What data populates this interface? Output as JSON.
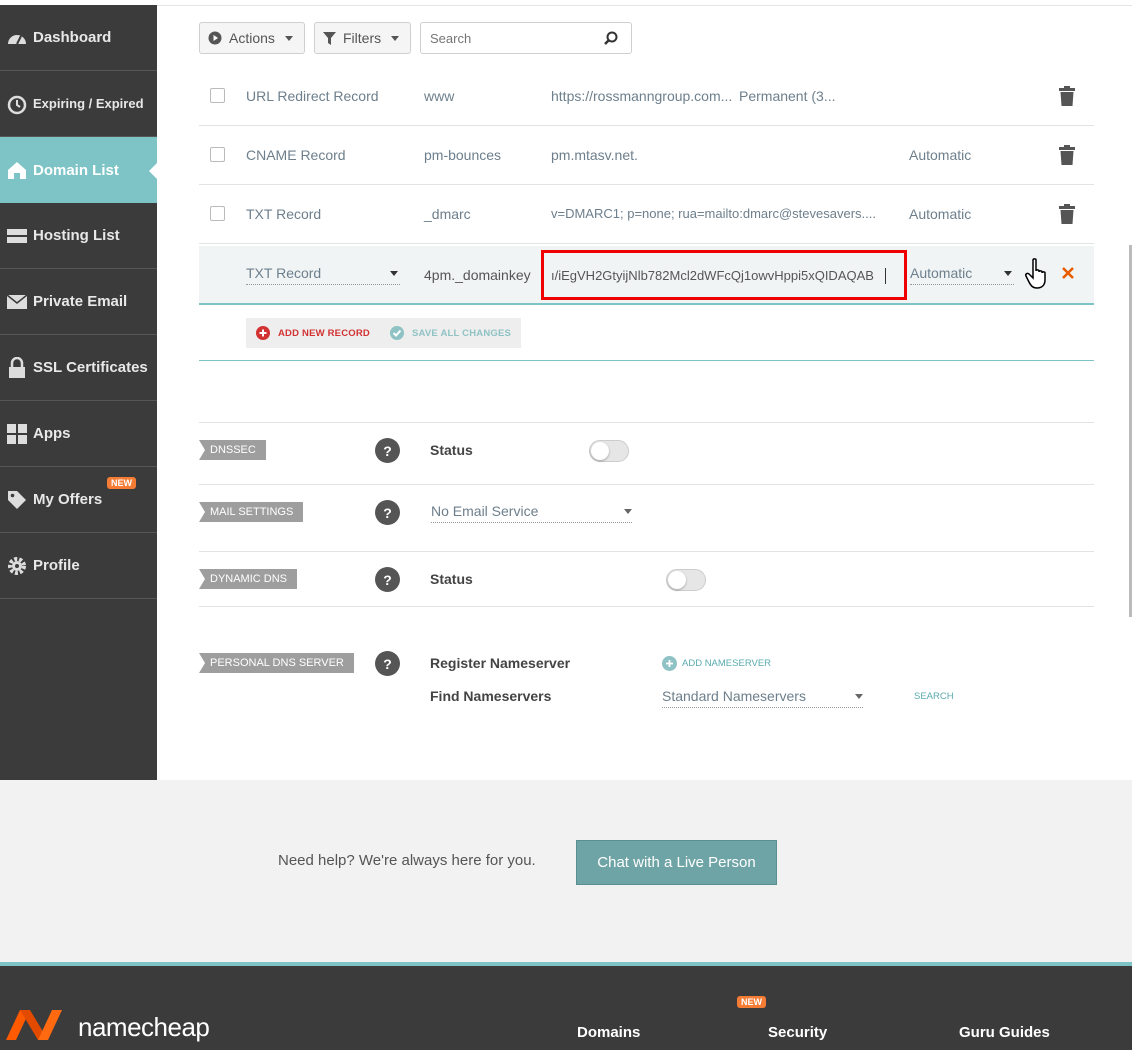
{
  "sidebar": {
    "items": [
      {
        "label": "Dashboard",
        "icon": "speedometer-icon"
      },
      {
        "label": "Expiring / Expired",
        "icon": "clock-icon"
      },
      {
        "label": "Domain List",
        "icon": "home-icon",
        "active": true
      },
      {
        "label": "Hosting List",
        "icon": "server-icon"
      },
      {
        "label": "Private Email",
        "icon": "envelope-icon"
      },
      {
        "label": "SSL Certificates",
        "icon": "lock-icon"
      },
      {
        "label": "Apps",
        "icon": "apps-grid-icon"
      },
      {
        "label": "My Offers",
        "icon": "tag-icon",
        "badge": "NEW"
      },
      {
        "label": "Profile",
        "icon": "gear-icon"
      }
    ]
  },
  "toolbar": {
    "actions_label": "Actions",
    "filters_label": "Filters",
    "search_placeholder": "Search"
  },
  "records": [
    {
      "type": "URL Redirect Record",
      "host": "www",
      "value": "https://rossmanngroup.com...",
      "extra": "Permanent (3...",
      "ttl": ""
    },
    {
      "type": "CNAME Record",
      "host": "pm-bounces",
      "value": "pm.mtasv.net.",
      "extra": "",
      "ttl": "Automatic"
    },
    {
      "type": "TXT Record",
      "host": "_dmarc",
      "value": "v=DMARC1; p=none; rua=mailto:dmarc@stevesavers....",
      "extra": "",
      "ttl": "Automatic"
    }
  ],
  "edit_record": {
    "type": "TXT Record",
    "host": "4pm._domainkey",
    "value": "ı/iEgVH2GtyijNlb782Mcl2dWFcQj1owvHppi5xQIDAQAB",
    "ttl": "Automatic"
  },
  "actions": {
    "add_new_record": "ADD NEW RECORD",
    "save_all_changes": "SAVE ALL CHANGES"
  },
  "sections": {
    "dnssec": {
      "tag": "DNSSEC",
      "label": "Status"
    },
    "mail": {
      "tag": "MAIL SETTINGS",
      "value": "No Email Service"
    },
    "dynamic": {
      "tag": "DYNAMIC DNS",
      "label": "Status"
    },
    "personal": {
      "tag": "PERSONAL DNS SERVER",
      "register_label": "Register Nameserver",
      "add_nameserver": "ADD NAMESERVER",
      "find_label": "Find Nameservers",
      "find_value": "Standard Nameservers",
      "search": "SEARCH"
    },
    "help_glyph": "?"
  },
  "help_band": {
    "text": "Need help? We're always here for you.",
    "button": "Chat with a Live Person"
  },
  "footer": {
    "logo": "namecheap",
    "badge": "NEW",
    "columns": [
      "Domains",
      "Security",
      "Guru Guides"
    ]
  },
  "colors": {
    "accent": "#7ec4c6",
    "sidebar": "#3b3b3b",
    "danger": "#e00000",
    "orange": "#f47c34"
  }
}
